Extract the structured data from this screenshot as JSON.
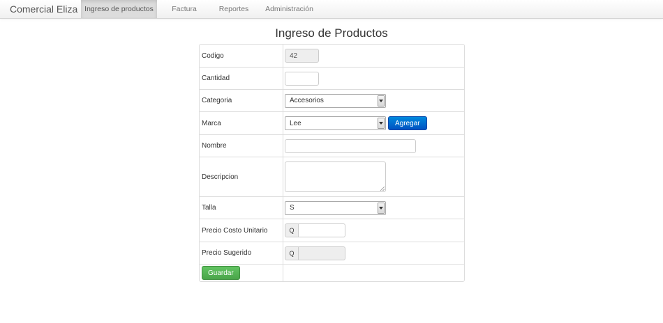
{
  "navbar": {
    "brand": "Comercial Eliza",
    "items": [
      {
        "label": "Ingreso de productos",
        "active": true
      },
      {
        "label": "Factura",
        "active": false
      },
      {
        "label": "Reportes",
        "active": false
      },
      {
        "label": "Administración",
        "active": false
      }
    ]
  },
  "page": {
    "title": "Ingreso de Productos"
  },
  "form": {
    "codigo": {
      "label": "Codigo",
      "value": "42"
    },
    "cantidad": {
      "label": "Cantidad",
      "value": ""
    },
    "categoria": {
      "label": "Categoria",
      "selected": "Accesorios"
    },
    "marca": {
      "label": "Marca",
      "selected": "Lee",
      "add_button": "Agregar"
    },
    "nombre": {
      "label": "Nombre",
      "value": ""
    },
    "descripcion": {
      "label": "Descripcion",
      "value": ""
    },
    "talla": {
      "label": "Talla",
      "selected": "S"
    },
    "precio_costo": {
      "label": "Precio Costo Unitario",
      "currency": "Q",
      "value": ""
    },
    "precio_sugerido": {
      "label": "Precio Sugerido",
      "currency": "Q",
      "value": ""
    },
    "submit": "Guardar"
  },
  "colors": {
    "primary": "#0063cc",
    "success": "#5bb75b",
    "active_nav": "#dcdcdc"
  }
}
